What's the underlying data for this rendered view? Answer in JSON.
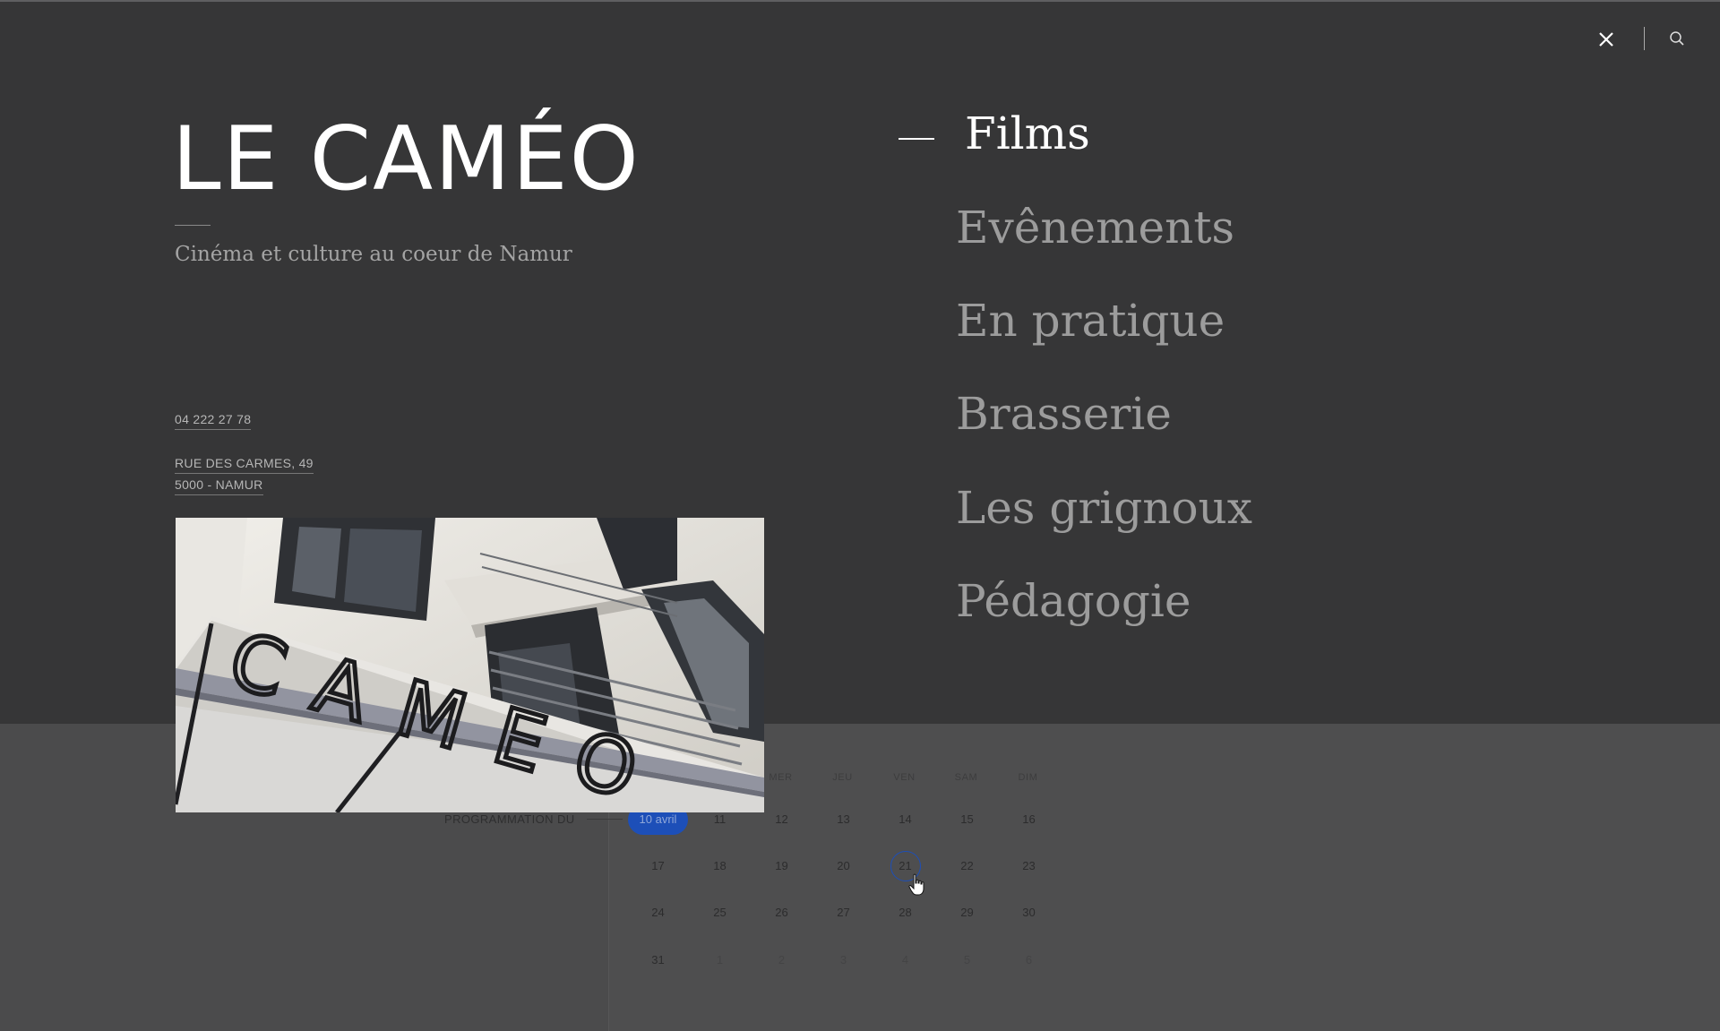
{
  "header": {
    "close_icon": "close-icon",
    "search_icon": "search-icon"
  },
  "brand": {
    "title": "LE CAMÉO",
    "tagline": "Cinéma et culture au coeur de Namur"
  },
  "contact": {
    "phone": "04 222 27 78",
    "street": "RUE DES CARMES, 49",
    "city": "5000 - NAMUR"
  },
  "photo": {
    "sign_text": "CAMEO"
  },
  "menu": {
    "items": [
      {
        "label": "Films",
        "active": true
      },
      {
        "label": "Evênements",
        "active": false
      },
      {
        "label": "En pratique",
        "active": false
      },
      {
        "label": "Brasserie",
        "active": false
      },
      {
        "label": "Les grignoux",
        "active": false
      },
      {
        "label": "Pédagogie",
        "active": false
      }
    ]
  },
  "calendar": {
    "label": "PROGRAMMATION DU",
    "day_names": [
      "MER",
      "JEU",
      "VEN",
      "SAM",
      "DIM"
    ],
    "weeks": [
      [
        "10 avril",
        "11",
        "12",
        "13",
        "14",
        "15",
        "16"
      ],
      [
        "17",
        "18",
        "19",
        "20",
        "21",
        "22",
        "23"
      ],
      [
        "24",
        "25",
        "26",
        "27",
        "28",
        "29",
        "30"
      ],
      [
        "31",
        "1",
        "2",
        "3",
        "4",
        "5",
        "6"
      ]
    ],
    "selected": "10 avril",
    "hovered": "21",
    "accent_color": "#1d4fb8"
  },
  "colors": {
    "overlay_bg": "#363637",
    "page_bg": "#4b4b4c",
    "active_text": "#ffffff",
    "inactive_text": "#9c9c9c"
  }
}
